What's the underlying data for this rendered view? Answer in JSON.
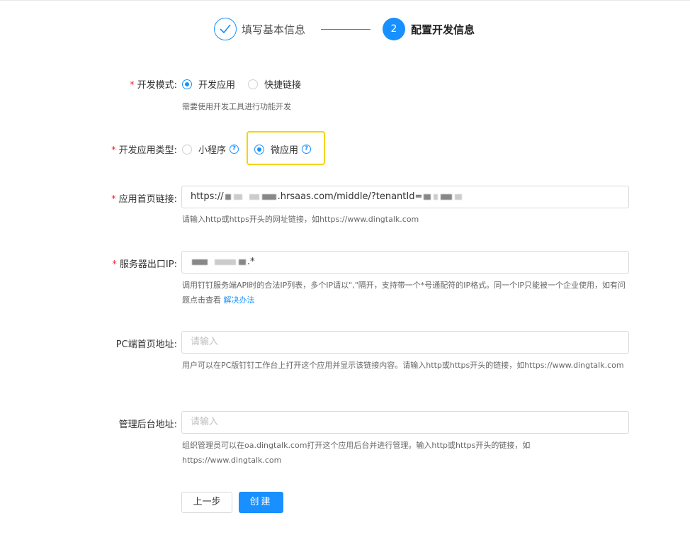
{
  "steps": [
    {
      "label": "填写基本信息",
      "status": "done"
    },
    {
      "number": "2",
      "label": "配置开发信息",
      "status": "active"
    }
  ],
  "form": {
    "required_mark": "*",
    "dev_mode": {
      "label": "开发模式",
      "colon": ":",
      "options": [
        {
          "label": "开发应用",
          "checked": true
        },
        {
          "label": "快捷链接",
          "checked": false
        }
      ],
      "hint": "需要使用开发工具进行功能开发"
    },
    "app_type": {
      "label": "开发应用类型",
      "colon": ":",
      "options": [
        {
          "label": "小程序",
          "checked": false,
          "help": "?"
        },
        {
          "label": "微应用",
          "checked": true,
          "help": "?"
        }
      ]
    },
    "homepage_link": {
      "label": "应用首页链接",
      "colon": ":",
      "value_prefix": "https://",
      "value_visible": ".hrsaas.com/middle/?tenantId=",
      "hint": "请输入http或https开头的网址链接，如https://www.dingtalk.com"
    },
    "server_ip": {
      "label": "服务器出口IP",
      "colon": ":",
      "value_suffix": ".*",
      "hint": "调用钉钉服务端API时的合法IP列表，多个IP请以\",\"隔开，支持带一个*号通配符的IP格式。同一个IP只能被一个企业使用，如有问题点击查看 ",
      "hint_link": "解决办法"
    },
    "pc_homepage": {
      "label": "PC端首页地址",
      "colon": ":",
      "placeholder": "请输入",
      "hint": "用户可以在PC版钉钉工作台上打开这个应用并显示该链接内容。请输入http或https开头的链接，如https://www.dingtalk.com"
    },
    "admin_url": {
      "label": "管理后台地址",
      "colon": ":",
      "placeholder": "请输入",
      "hint": "组织管理员可以在oa.dingtalk.com打开这个应用后台并进行管理。输入http或https开头的链接，如https://www.dingtalk.com"
    }
  },
  "buttons": {
    "prev": "上一步",
    "create": "创建"
  },
  "colors": {
    "primary": "#1890ff",
    "required": "#f5222d",
    "highlight": "#f5d400"
  }
}
